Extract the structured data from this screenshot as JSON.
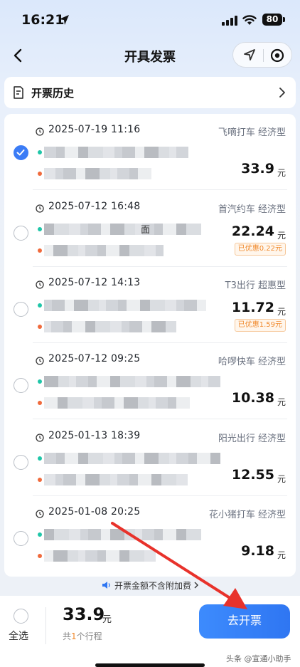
{
  "status_bar": {
    "time": "16:21",
    "battery": "80"
  },
  "nav": {
    "title": "开具发票"
  },
  "history": {
    "label": "开票历史"
  },
  "trips": [
    {
      "time": "2025-07-19 11:16",
      "provider": "飞嘀打车 经济型",
      "amount": "33.9",
      "yuan": "元",
      "discount": "",
      "checked": true
    },
    {
      "time": "2025-07-12 16:48",
      "provider": "首汽约车 经济型",
      "amount": "22.24",
      "yuan": "元",
      "discount": "已优惠0.22元",
      "checked": false,
      "addr_frag": "面"
    },
    {
      "time": "2025-07-12 14:13",
      "provider": "T3出行 超惠型",
      "amount": "11.72",
      "yuan": "元",
      "discount": "已优惠1.59元",
      "checked": false
    },
    {
      "time": "2025-07-12 09:25",
      "provider": "哈啰快车 经济型",
      "amount": "10.38",
      "yuan": "元",
      "discount": "",
      "checked": false
    },
    {
      "time": "2025-01-13 18:39",
      "provider": "阳光出行 经济型",
      "amount": "12.55",
      "yuan": "元",
      "discount": "",
      "checked": false
    },
    {
      "time": "2025-01-08 20:25",
      "provider": "花小猪打车 经济型",
      "amount": "9.18",
      "yuan": "元",
      "discount": "",
      "checked": false
    }
  ],
  "notice": {
    "text": "开票金额不含附加费"
  },
  "footer": {
    "select_all": "全选",
    "total_amount": "33.9",
    "total_yuan": "元",
    "count_prefix": "共",
    "count_num": "1",
    "count_suffix": "个行程",
    "invoice_button": "去开票",
    "watermark": "头条 @宣通小助手"
  },
  "colors": {
    "accent": "#3b7cf6",
    "discount": "#f08a2e",
    "arrow": "#e8322b"
  }
}
